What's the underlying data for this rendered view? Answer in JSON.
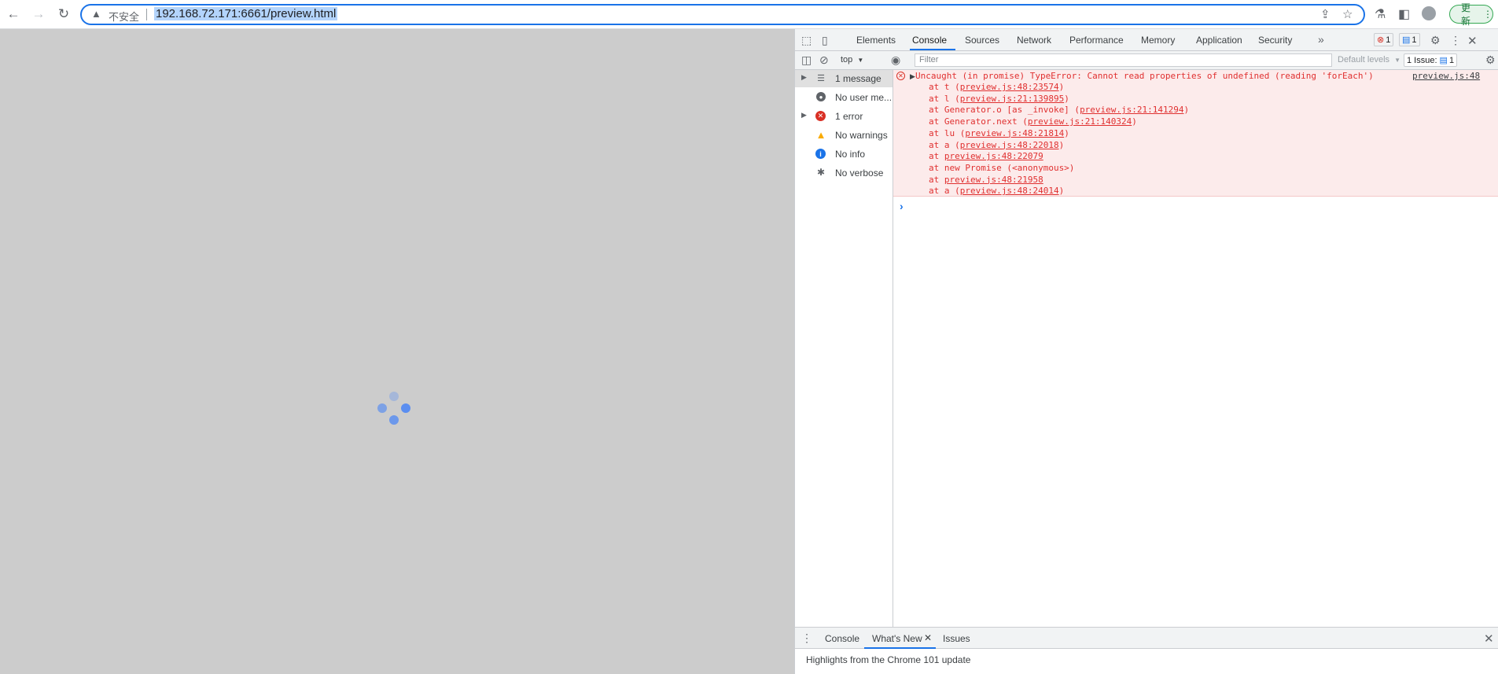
{
  "browser": {
    "back_icon": "arrow-left",
    "forward_icon": "arrow-right",
    "reload_icon": "reload",
    "omnibox": {
      "security_text": "不安全",
      "url": "192.168.72.171:6661/preview.html"
    },
    "update_label": "更新"
  },
  "page": {
    "spinner": "loading-dots",
    "accent": "#5b8ef0"
  },
  "devtools": {
    "tabs": [
      "Elements",
      "Console",
      "Sources",
      "Network",
      "Performance",
      "Memory",
      "Application",
      "Security"
    ],
    "active_tab": "Console",
    "error_count": "1",
    "message_count": "1",
    "toolbar": {
      "context": "top",
      "filter_placeholder": "Filter",
      "levels": "Default levels",
      "issues_label": "1 Issue:",
      "issues_count": "1"
    },
    "sidebar": [
      {
        "label": "1 message",
        "icon": "list-icon",
        "expandable": true
      },
      {
        "label": "No user me...",
        "icon": "user-icon",
        "expandable": false
      },
      {
        "label": "1 error",
        "icon": "error-icon",
        "expandable": true
      },
      {
        "label": "No warnings",
        "icon": "warning-icon",
        "expandable": false
      },
      {
        "label": "No info",
        "icon": "info-icon",
        "expandable": false
      },
      {
        "label": "No verbose",
        "icon": "bug-icon",
        "expandable": false
      }
    ],
    "console": {
      "error": {
        "message": "Uncaught (in promise) TypeError: Cannot read properties of undefined (reading 'forEach')",
        "source": "preview.js:48",
        "stack": [
          {
            "prefix": "at t (",
            "link": "preview.js:48:23574",
            "suffix": ")"
          },
          {
            "prefix": "at l (",
            "link": "preview.js:21:139895",
            "suffix": ")"
          },
          {
            "prefix": "at Generator.o [as _invoke] (",
            "link": "preview.js:21:141294",
            "suffix": ")"
          },
          {
            "prefix": "at Generator.next (",
            "link": "preview.js:21:140324",
            "suffix": ")"
          },
          {
            "prefix": "at lu (",
            "link": "preview.js:48:21814",
            "suffix": ")"
          },
          {
            "prefix": "at a (",
            "link": "preview.js:48:22018",
            "suffix": ")"
          },
          {
            "prefix": "at ",
            "link": "preview.js:48:22079",
            "suffix": ""
          },
          {
            "prefix": "at new Promise (<anonymous>)",
            "link": "",
            "suffix": ""
          },
          {
            "prefix": "at ",
            "link": "preview.js:48:21958",
            "suffix": ""
          },
          {
            "prefix": "at a (",
            "link": "preview.js:48:24014",
            "suffix": ")"
          }
        ]
      },
      "prompt": "›"
    },
    "drawer": {
      "tabs": [
        "Console",
        "What's New",
        "Issues"
      ],
      "active_tab": "What's New",
      "highlights": "Highlights from the Chrome 101 update"
    }
  }
}
